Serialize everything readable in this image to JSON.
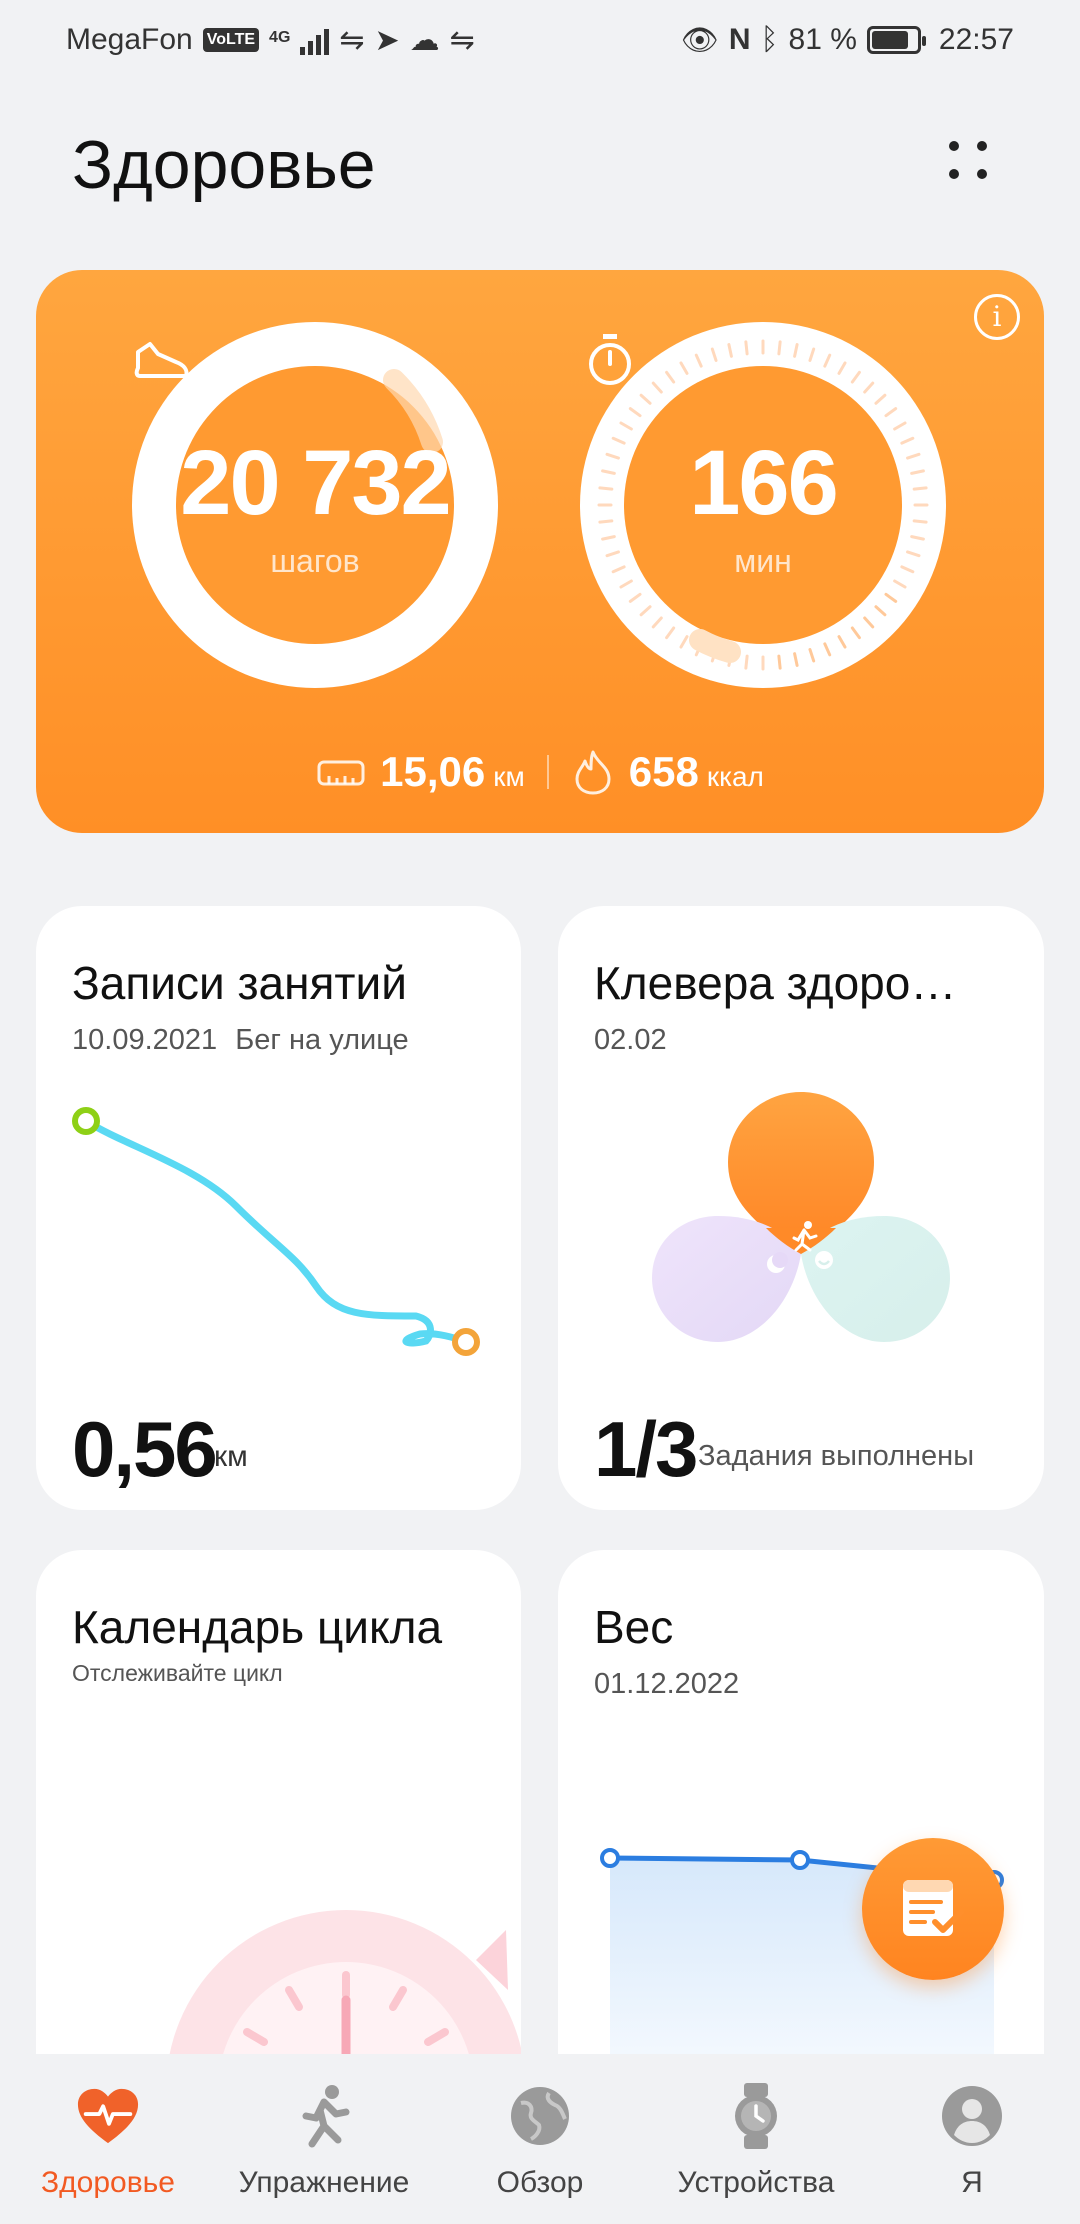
{
  "status_bar": {
    "carrier": "MegaFon",
    "volte": "VoLTE",
    "network": "4G",
    "battery_percent": "81 %",
    "battery_level": 0.81,
    "time": "22:57",
    "icons": [
      "signal-icon",
      "link-icon",
      "telegram-icon",
      "cloud-icon",
      "link-icon",
      "eye-icon",
      "nfc-icon",
      "bluetooth-icon",
      "battery-icon"
    ]
  },
  "header": {
    "title": "Здоровье",
    "menu_icon": "more-dots-icon"
  },
  "activity": {
    "steps_value": "20 732",
    "steps_unit": "шагов",
    "steps_icon": "shoe-icon",
    "minutes_value": "166",
    "minutes_unit": "мин",
    "minutes_icon": "stopwatch-icon",
    "distance_value": "15,06",
    "distance_unit": "км",
    "distance_icon": "ruler-icon",
    "calories_value": "658",
    "calories_unit": "ккал",
    "calories_icon": "flame-icon",
    "info_icon": "info-icon",
    "accent": "#ff9a31"
  },
  "cards": {
    "workout": {
      "title": "Записи занятий",
      "date": "10.09.2021",
      "type": "Бег на улице",
      "value": "0,56",
      "unit": "км"
    },
    "clover": {
      "title": "Клевера здоро…",
      "date": "02.02",
      "value": "1/3",
      "caption": "Задания выполнены"
    },
    "cycle": {
      "title": "Календарь цикла",
      "subtitle": "Отслеживайте цикл"
    },
    "weight": {
      "title": "Вес",
      "date": "01.12.2022"
    }
  },
  "fab": {
    "icon": "checklist-icon"
  },
  "bottom_nav": [
    {
      "label": "Здоровье",
      "icon": "heart-pulse-icon",
      "active": true
    },
    {
      "label": "Упражнение",
      "icon": "runner-icon",
      "active": false
    },
    {
      "label": "Обзор",
      "icon": "globe-icon",
      "active": false
    },
    {
      "label": "Устройства",
      "icon": "watch-icon",
      "active": false
    },
    {
      "label": "Я",
      "icon": "person-icon",
      "active": false
    }
  ]
}
